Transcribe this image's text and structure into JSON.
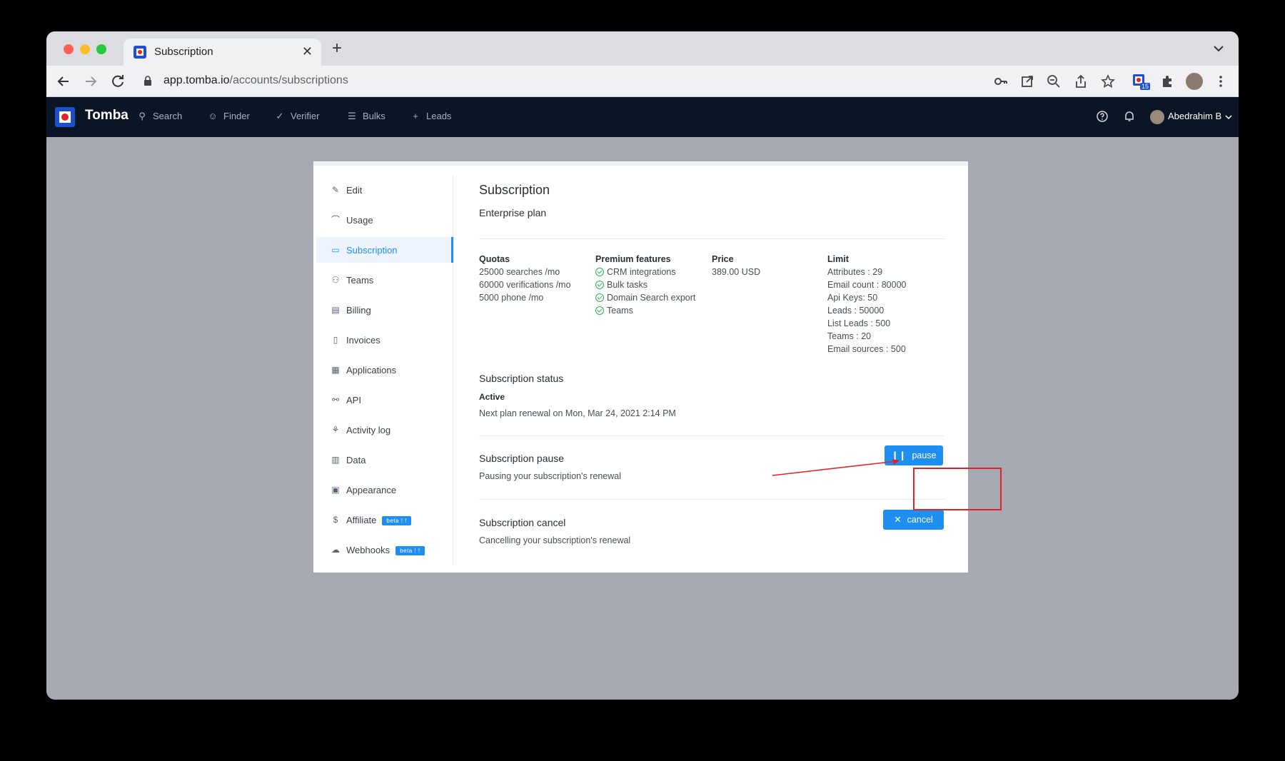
{
  "browser": {
    "tab_title": "Subscription",
    "url_host": "app.tomba.io",
    "url_path": "/accounts/subscriptions",
    "extension_badge": "15"
  },
  "app_nav": {
    "brand": "Tomba",
    "items": [
      {
        "label": "Search",
        "icon": "search-icon"
      },
      {
        "label": "Finder",
        "icon": "user-icon"
      },
      {
        "label": "Verifier",
        "icon": "check-icon"
      },
      {
        "label": "Bulks",
        "icon": "list-icon"
      },
      {
        "label": "Leads",
        "icon": "plus-icon"
      }
    ],
    "user_name": "Abedrahim B"
  },
  "sidebar": {
    "items": [
      {
        "label": "Edit",
        "icon": "edit-icon"
      },
      {
        "label": "Usage",
        "icon": "chart-icon"
      },
      {
        "label": "Subscription",
        "icon": "credit-card-icon",
        "active": true
      },
      {
        "label": "Teams",
        "icon": "team-icon"
      },
      {
        "label": "Billing",
        "icon": "billing-icon"
      },
      {
        "label": "Invoices",
        "icon": "invoice-icon"
      },
      {
        "label": "Applications",
        "icon": "apps-icon"
      },
      {
        "label": "API",
        "icon": "api-icon"
      },
      {
        "label": "Activity log",
        "icon": "activity-icon"
      },
      {
        "label": "Data",
        "icon": "data-icon"
      },
      {
        "label": "Appearance",
        "icon": "appearance-icon"
      },
      {
        "label": "Affiliate",
        "icon": "dollar-icon",
        "badge": "beta ! !"
      },
      {
        "label": "Webhooks",
        "icon": "webhook-icon",
        "badge": "beta ! !"
      }
    ]
  },
  "subscription": {
    "title": "Subscription",
    "plan": "Enterprise plan",
    "quotas": {
      "header": "Quotas",
      "lines": [
        "25000 searches /mo",
        "60000 verifications /mo",
        "5000 phone /mo"
      ]
    },
    "premium": {
      "header": "Premium features",
      "lines": [
        "CRM integrations",
        "Bulk tasks",
        "Domain Search export",
        "Teams"
      ]
    },
    "price": {
      "header": "Price",
      "value": "389.00 USD"
    },
    "limit": {
      "header": "Limit",
      "lines": [
        "Attributes : 29",
        "Email count : 80000",
        "Api Keys: 50",
        "Leads : 50000",
        "List Leads : 500",
        "Teams : 20",
        "Email sources : 500"
      ]
    },
    "status": {
      "title": "Subscription status",
      "value": "Active",
      "renewal": "Next plan renewal on Mon, Mar 24, 2021 2:14 PM"
    },
    "pause": {
      "title": "Subscription pause",
      "subtitle": "Pausing your subscription's renewal",
      "button": "pause"
    },
    "cancel": {
      "title": "Subscription cancel",
      "subtitle": "Cancelling your subscription's renewal",
      "button": "cancel"
    }
  },
  "colors": {
    "accent": "#1f8ef1",
    "nav_bg": "#0c1526",
    "annotation": "#e0222b",
    "check": "#2eb350"
  }
}
